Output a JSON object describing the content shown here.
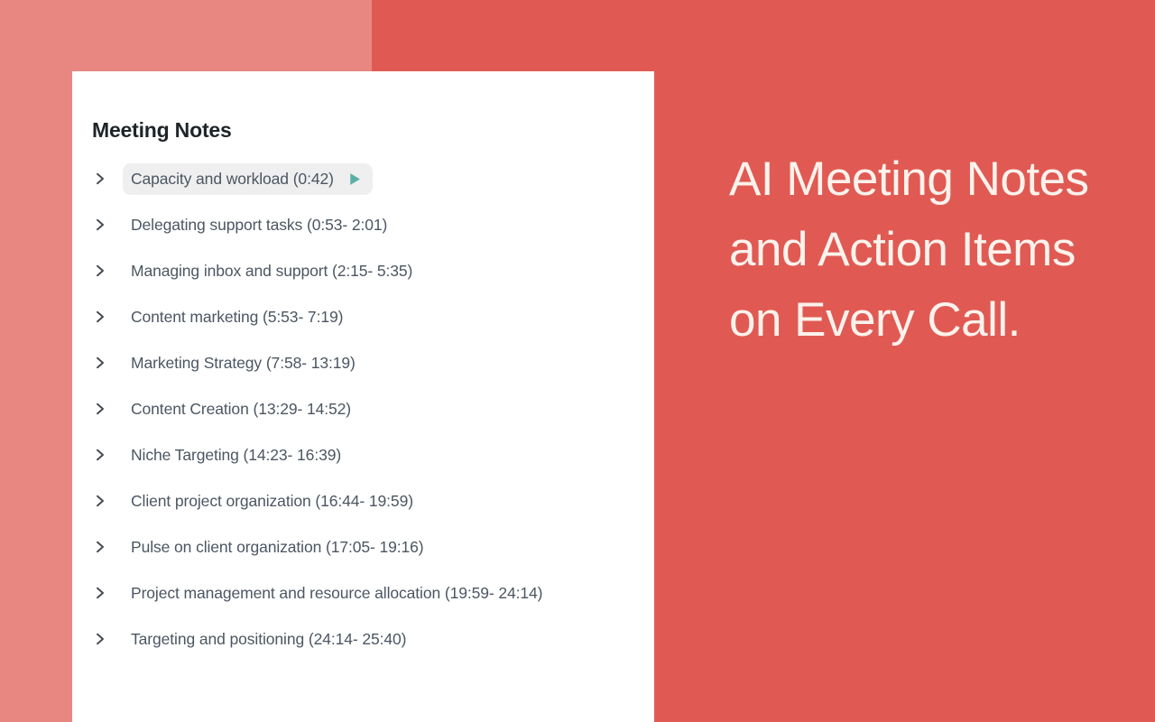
{
  "theme": {
    "bg_left": "#E88781",
    "bg_right": "#E05A53",
    "card_bg": "#FFFFFF",
    "headline_color": "#FBF2EC",
    "item_text_color": "#4C5662",
    "active_pill_bg": "#EFEFEF",
    "play_icon_color": "#5BAFA4",
    "chevron_color": "#434A52"
  },
  "card": {
    "title": "Meeting Notes",
    "items": [
      {
        "label": "Capacity and workload (0:42)",
        "active": true,
        "has_play": true
      },
      {
        "label": "Delegating support tasks (0:53- 2:01)",
        "active": false,
        "has_play": false
      },
      {
        "label": "Managing inbox and support (2:15- 5:35)",
        "active": false,
        "has_play": false
      },
      {
        "label": "Content marketing (5:53- 7:19)",
        "active": false,
        "has_play": false
      },
      {
        "label": "Marketing Strategy (7:58- 13:19)",
        "active": false,
        "has_play": false
      },
      {
        "label": "Content Creation (13:29- 14:52)",
        "active": false,
        "has_play": false
      },
      {
        "label": "Niche Targeting (14:23- 16:39)",
        "active": false,
        "has_play": false
      },
      {
        "label": "Client project organization (16:44- 19:59)",
        "active": false,
        "has_play": false
      },
      {
        "label": "Pulse on client organization (17:05- 19:16)",
        "active": false,
        "has_play": false
      },
      {
        "label": "Project management and resource allocation (19:59- 24:14)",
        "active": false,
        "has_play": false
      },
      {
        "label": "Targeting and positioning (24:14- 25:40)",
        "active": false,
        "has_play": false
      }
    ]
  },
  "headline": {
    "text": "AI Meeting Notes and Action Items on Every Call."
  },
  "icons": {
    "chevron": "chevron-right-icon",
    "play": "play-icon"
  }
}
